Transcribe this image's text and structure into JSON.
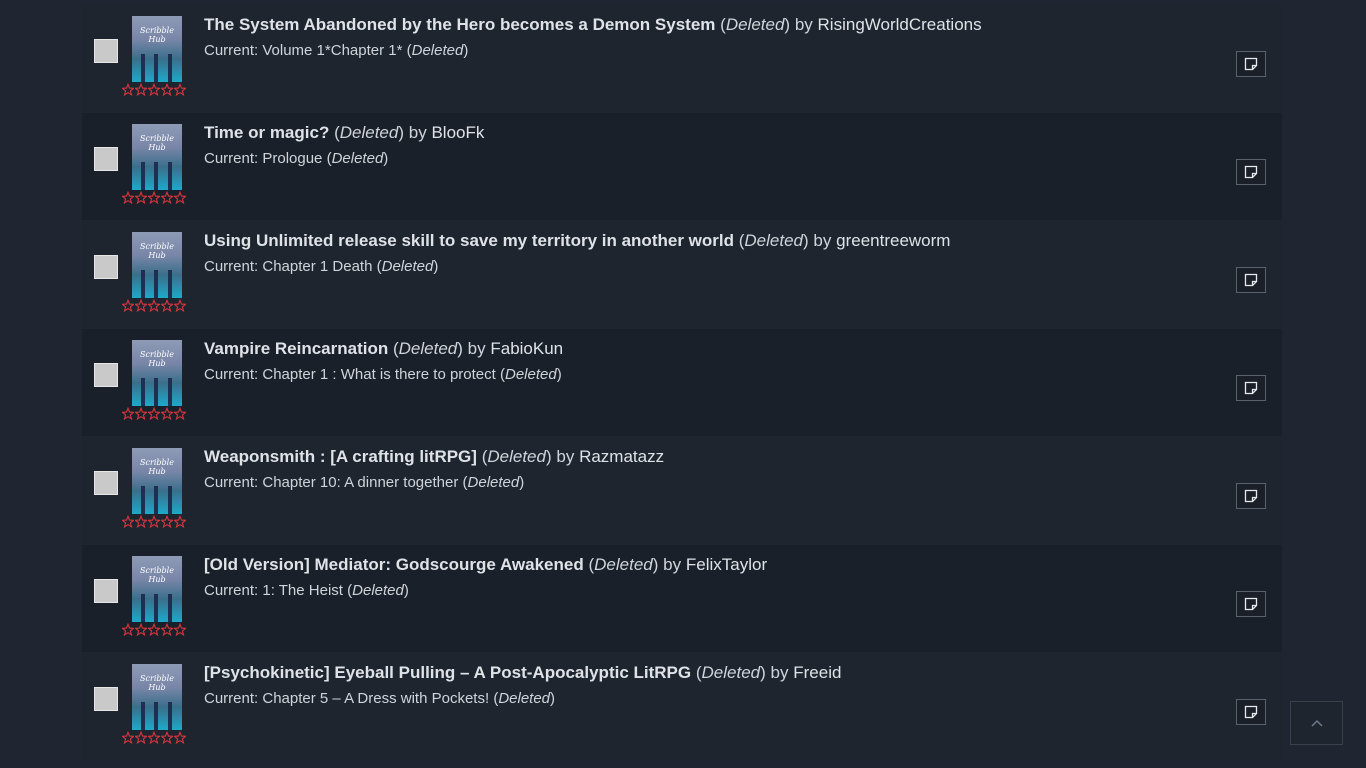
{
  "colors": {
    "background": "#1f2631",
    "row_even": "#1e252f",
    "row_odd": "#1a2029",
    "star_outline": "#d9363e",
    "checkbox": "#c9c9c9"
  },
  "cover_logo_text": "Scribble Hub",
  "row_icons": {
    "rating": "star-outline-icon",
    "note": "sticky-note-icon"
  },
  "scroll_top_icon": "chevron-up-icon",
  "entries": [
    {
      "title": "The System Abandoned by the Hero becomes a Demon System",
      "status": "Deleted",
      "by": "by",
      "author": "RisingWorldCreations",
      "current_prefix": "Current:",
      "current_chapter": "Volume 1*Chapter 1*",
      "current_status": "Deleted",
      "rating_stars": 0
    },
    {
      "title": "Time or magic?",
      "status": "Deleted",
      "by": "by",
      "author": "BlooFk",
      "current_prefix": "Current:",
      "current_chapter": "Prologue",
      "current_status": "Deleted",
      "rating_stars": 0
    },
    {
      "title": "Using Unlimited release skill to save my territory in another world",
      "status": "Deleted",
      "by": "by",
      "author": "greentreeworm",
      "current_prefix": "Current:",
      "current_chapter": "Chapter 1 Death",
      "current_status": "Deleted",
      "rating_stars": 0
    },
    {
      "title": "Vampire Reincarnation",
      "status": "Deleted",
      "by": "by",
      "author": "FabioKun",
      "current_prefix": "Current:",
      "current_chapter": "Chapter 1 : What is there to protect",
      "current_status": "Deleted",
      "rating_stars": 0
    },
    {
      "title": "Weaponsmith : [A crafting litRPG]",
      "status": "Deleted",
      "by": "by",
      "author": "Razmatazz",
      "current_prefix": "Current:",
      "current_chapter": "Chapter 10: A dinner together",
      "current_status": "Deleted",
      "rating_stars": 0
    },
    {
      "title": "[Old Version] Mediator: Godscourge Awakened",
      "status": "Deleted",
      "by": "by",
      "author": "FelixTaylor",
      "current_prefix": "Current:",
      "current_chapter": "1: The Heist",
      "current_status": "Deleted",
      "rating_stars": 0
    },
    {
      "title": "[Psychokinetic] Eyeball Pulling – A Post-Apocalyptic LitRPG",
      "status": "Deleted",
      "by": "by",
      "author": "Freeid",
      "current_prefix": "Current:",
      "current_chapter": "Chapter 5 – A Dress with Pockets!",
      "current_status": "Deleted",
      "rating_stars": 0
    }
  ]
}
